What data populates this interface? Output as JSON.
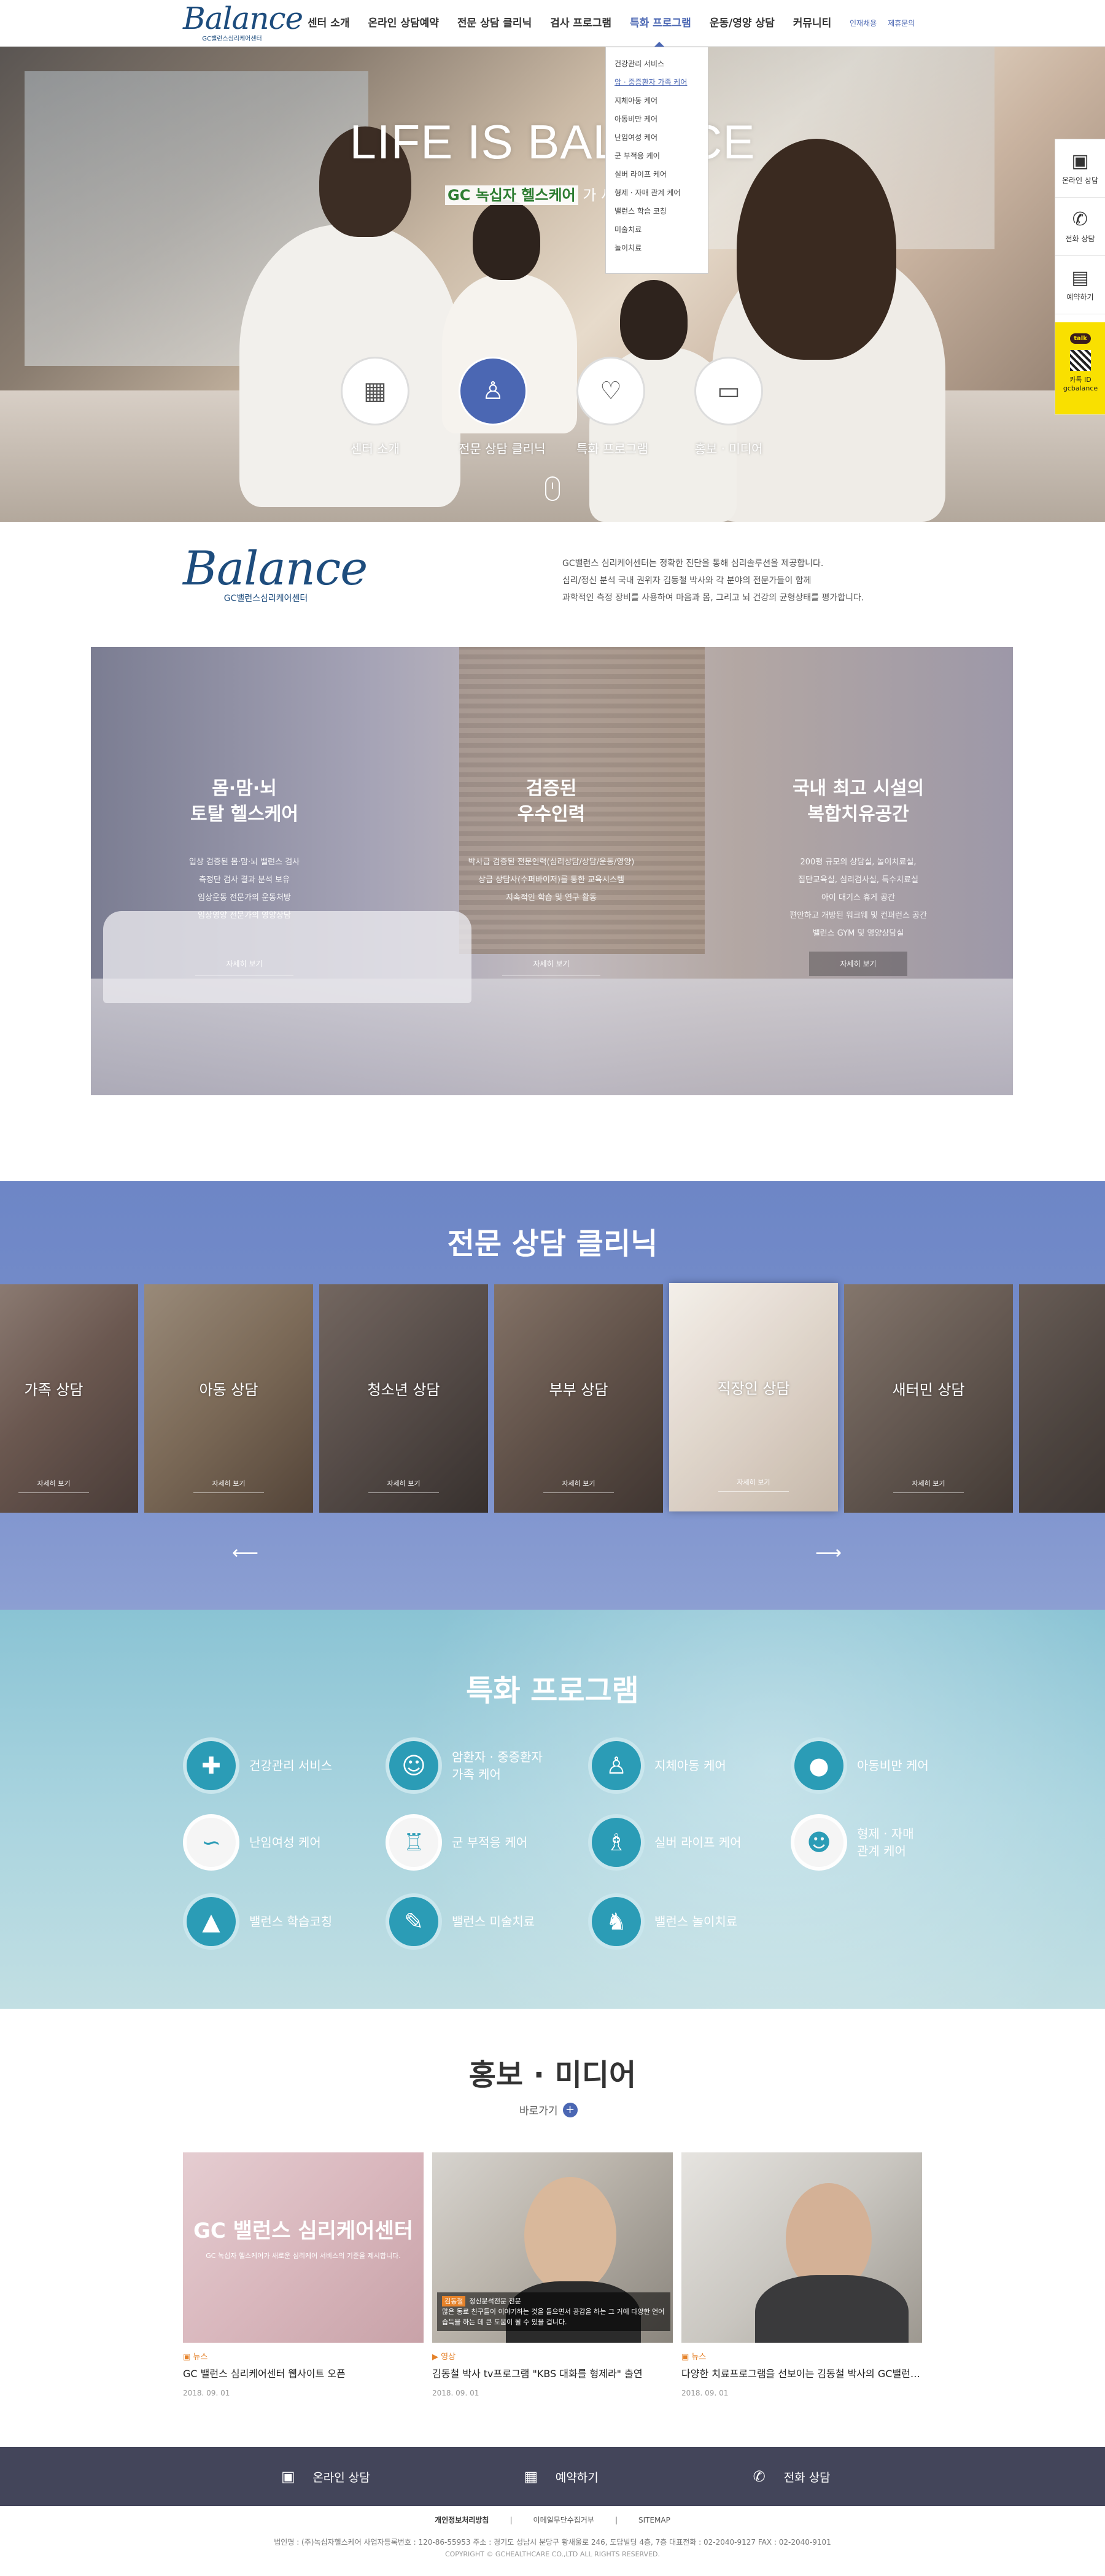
{
  "header": {
    "logo_text": "Balance",
    "logo_sub": "GC밸런스심리케어센터",
    "nav": [
      "센터 소개",
      "온라인 상담예약",
      "전문 상담 클리닉",
      "검사 프로그램",
      "특화 프로그램",
      "운동/영양 상담",
      "커뮤니티"
    ],
    "util": [
      "인재채용",
      "제휴문의"
    ],
    "active_nav": "특화 프로그램"
  },
  "dropdown": {
    "items": [
      "건강관리 서비스",
      "암 · 중증환자 가족 케어",
      "지체아동 케어",
      "아동비만 케어",
      "난임여성 케어",
      "군 부적응 케어",
      "실버 라이프 케어",
      "형제 · 자매 관계 케어",
      "밸런스 학습 코칭",
      "미술치료",
      "놀이치료"
    ],
    "active_index": 1
  },
  "hero": {
    "title": "LIFE IS BALANCE",
    "subtitle_brand": "GC 녹십자 헬스케어",
    "subtitle_rest": "가 새로운 문",
    "circles": [
      {
        "label": "센터 소개",
        "icon": "building-icon",
        "glyph": "▦"
      },
      {
        "label": "전문 상담 클리닉",
        "icon": "counselor-icon",
        "glyph": "♙"
      },
      {
        "label": "특화 프로그램",
        "icon": "heart-hands-icon",
        "glyph": "♡"
      },
      {
        "label": "홍보 · 미디어",
        "icon": "monitor-news-icon",
        "glyph": "▭"
      }
    ]
  },
  "quick": {
    "items": [
      {
        "label": "온라인 상담",
        "icon": "monitor-chat-icon",
        "glyph": "▣"
      },
      {
        "label": "전화 상담",
        "icon": "phone-icon",
        "glyph": "✆"
      },
      {
        "label": "예약하기",
        "icon": "clipboard-icon",
        "glyph": "▤"
      }
    ],
    "kakao_badge": "talk",
    "kakao_id": "카톡 ID",
    "kakao_name": "gcbalance"
  },
  "intro": {
    "logo_text": "Balance",
    "logo_sub": "GC밸런스심리케어센터",
    "lines": [
      "GC밸런스 심리케어센터는 정확한 진단을 통해 심리솔루션을 제공합니다.",
      "심리/정신 분석 국내 권위자 김동철 박사와 각 분야의 전문가들이 함께",
      "과학적인 측정 장비를 사용하여 마음과 몸, 그리고 뇌 건강의 균형상태를 평가합니다."
    ]
  },
  "features": [
    {
      "title": "몸·맘·뇌\n토탈 헬스케어",
      "desc": "입상 검증된 몸·맘·뇌 밸런스 검사\n측정단 검사 결과 분석 보유\n임상운동 전문가의 운동처방\n임상영양 전문가의 영양상담",
      "button": "자세히 보기"
    },
    {
      "title": "검증된\n우수인력",
      "desc": "박사급 검증된 전문인력(심리상담/상담/운동/영양)\n상급 상담사(수퍼바이저)를 통한 교육시스템\n지속적인 학습 및 연구 활동",
      "button": "자세히 보기"
    },
    {
      "title": "국내 최고 시설의\n복합치유공간",
      "desc": "200평 규모의 상담실, 놀이치료실,\n집단교육실, 심리검사실, 특수치료실\n아이 대기스 휴게 공간\n편안하고 개방된 워크웨 및 컨퍼런스 공간\n밸런스 GYM 및 영양상담실",
      "button": "자세히 보기"
    }
  ],
  "clinic": {
    "title": "전문 상담 클리닉",
    "cards": [
      {
        "name": "가족 상담",
        "button": "자세히 보기"
      },
      {
        "name": "아동 상담",
        "button": "자세히 보기"
      },
      {
        "name": "청소년 상담",
        "button": "자세히 보기"
      },
      {
        "name": "부부 상담",
        "button": "자세히 보기"
      },
      {
        "name": "직장인 상담",
        "button": "자세히 보기"
      },
      {
        "name": "새터민 상담",
        "button": "자세히 보기"
      },
      {
        "name": "",
        "button": ""
      }
    ],
    "active_index": 4,
    "prev": "⟵",
    "next": "⟶"
  },
  "special": {
    "title": "특화 프로그램",
    "items": [
      {
        "label": "건강관리 서비스",
        "icon": "health-shield-icon",
        "glyph": "✚",
        "light": false
      },
      {
        "label": "암환자 · 중증환자\n가족 케어",
        "icon": "family-group-icon",
        "glyph": "☺",
        "light": false
      },
      {
        "label": "지체아동 케어",
        "icon": "parent-child-icon",
        "glyph": "♙",
        "light": false
      },
      {
        "label": "아동비만 케어",
        "icon": "child-body-icon",
        "glyph": "●",
        "light": false
      },
      {
        "label": "난임여성 케어",
        "icon": "sperm-egg-icon",
        "glyph": "∽",
        "light": true
      },
      {
        "label": "군 부적응 케어",
        "icon": "soldier-icon",
        "glyph": "♖",
        "light": true
      },
      {
        "label": "실버 라이프 케어",
        "icon": "elderly-cane-icon",
        "glyph": "♗",
        "light": false
      },
      {
        "label": "형제 · 자매\n관계 케어",
        "icon": "siblings-icon",
        "glyph": "☻",
        "light": true
      },
      {
        "label": "밸런스 학습코칭",
        "icon": "graduation-cap-icon",
        "glyph": "▲",
        "light": false
      },
      {
        "label": "밸런스 미술치료",
        "icon": "palette-icon",
        "glyph": "✎",
        "light": false
      },
      {
        "label": "밸런스 놀이치료",
        "icon": "rocking-horse-icon",
        "glyph": "♞",
        "light": false
      }
    ]
  },
  "media": {
    "title": "홍보 · 미디어",
    "more": "바로가기",
    "more_icon": "+",
    "cards": [
      {
        "category": "뉴스",
        "title": "GC 밸런스 심리케어센터 웹사이트 오픈",
        "date": "2018. 09. 01",
        "thumb_big": "GC 밸런스 심리케어센터",
        "thumb_small": "GC 녹십자 헬스케어가 새로운 심리케어 서비스의 기준을 제시합니다."
      },
      {
        "category": "영상",
        "title": "김동철 박사 tv프로그램 \"KBS 대화를 형제라\" 출연",
        "date": "2018. 09. 01",
        "caption_tag": "김동철",
        "caption_tag2": "정신분석전문 전문",
        "caption": "많은 동료 친구들이 이야기하는 것을 들으면서 공감을 하는 그 거에 다양한 언어 습득을 하는 데 큰 도움이 될 수 있을 겁니다."
      },
      {
        "category": "뉴스",
        "title": "다양한 치료프로그램을 선보이는 김동철 박사의 GC밸런스...",
        "date": "2018. 09. 01"
      }
    ]
  },
  "footer": {
    "bar": [
      {
        "label": "온라인 상담",
        "icon": "monitor-chat-icon",
        "glyph": "▣"
      },
      {
        "label": "예약하기",
        "icon": "calendar-icon",
        "glyph": "▦"
      },
      {
        "label": "전화 상담",
        "icon": "phone-icon",
        "glyph": "✆"
      }
    ],
    "links": [
      "개인정보처리방침",
      "이메일무단수집거부",
      "SITEMAP"
    ],
    "address": "법인명 : (주)녹십자헬스케어    사업자등록번호 : 120-86-55953    주소 : 경기도 성남시 분당구 황새울로 246, 도담빌딩 4층, 7층   대표전화 : 02-2040-9127   FAX : 02-2040-9101",
    "copyright": "COPYRIGHT © GCHEALTHCARE CO.,LTD ALL RIGHTS RESERVED."
  },
  "colors": {
    "accent": "#4b67b3",
    "clinic_bg": "#7a90cd",
    "special_icon": "#2b9cb6",
    "footer_bar": "#43455a",
    "media_category": "#e5822a"
  }
}
